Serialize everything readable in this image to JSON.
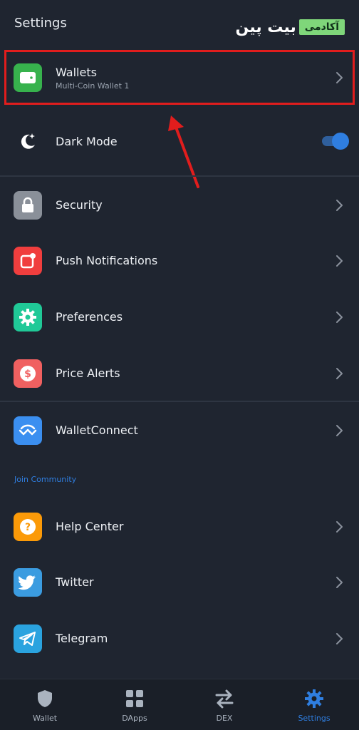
{
  "header": {
    "title": "Settings",
    "logo_text": "بیت پین",
    "logo_badge": "آکادمی"
  },
  "items": [
    {
      "label": "Wallets",
      "sublabel": "Multi-Coin Wallet 1",
      "icon": "wallet-icon",
      "color": "#37b24d"
    },
    {
      "label": "Dark Mode",
      "icon": "moon-icon",
      "color": "#1f2530",
      "toggle": true
    },
    {
      "label": "Security",
      "icon": "lock-icon",
      "color": "#8a9099"
    },
    {
      "label": "Push Notifications",
      "icon": "notification-icon",
      "color": "#f03e3e"
    },
    {
      "label": "Preferences",
      "icon": "gear-icon",
      "color": "#20c997"
    },
    {
      "label": "Price Alerts",
      "icon": "dollar-icon",
      "color": "#f06060"
    },
    {
      "label": "WalletConnect",
      "icon": "walletconnect-icon",
      "color": "#3b8ff0"
    },
    {
      "label": "Help Center",
      "icon": "help-icon",
      "color": "#fb9a08"
    },
    {
      "label": "Twitter",
      "icon": "twitter-icon",
      "color": "#3b9ce0"
    },
    {
      "label": "Telegram",
      "icon": "telegram-icon",
      "color": "#2aa3df"
    }
  ],
  "section": {
    "join_community": "Join Community"
  },
  "tabs": [
    {
      "label": "Wallet",
      "icon": "shield-icon"
    },
    {
      "label": "DApps",
      "icon": "grid-icon"
    },
    {
      "label": "DEX",
      "icon": "swap-icon"
    },
    {
      "label": "Settings",
      "icon": "gear-icon",
      "active": true
    }
  ],
  "colors": {
    "accent": "#2f7ee0",
    "background": "#1f2530",
    "highlight": "#e11d1d"
  }
}
